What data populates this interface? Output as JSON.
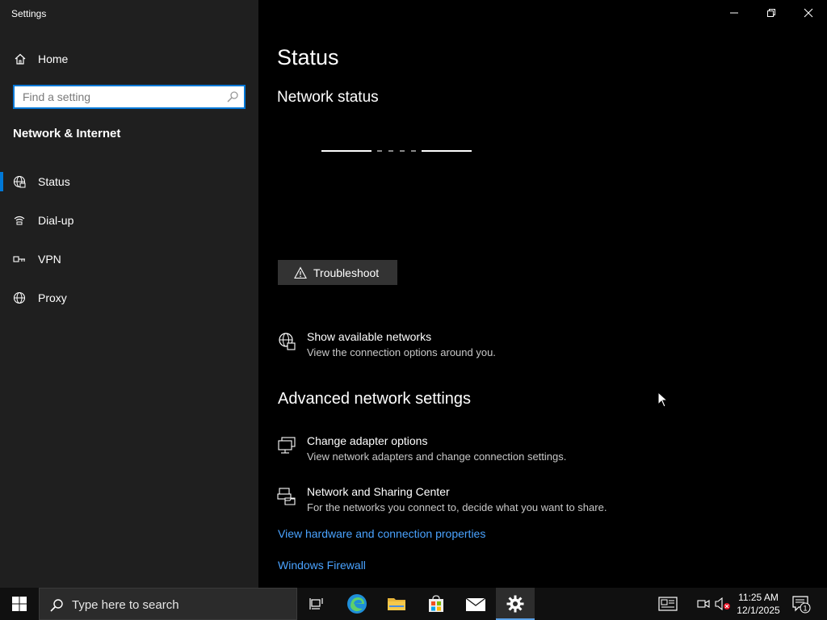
{
  "window": {
    "app_title": "Settings"
  },
  "sidebar": {
    "home_label": "Home",
    "search_placeholder": "Find a setting",
    "section_title": "Network & Internet",
    "items": [
      {
        "label": "Status",
        "icon": "globe-status-icon",
        "active": true
      },
      {
        "label": "Dial-up",
        "icon": "dialup-icon",
        "active": false
      },
      {
        "label": "VPN",
        "icon": "vpn-icon",
        "active": false
      },
      {
        "label": "Proxy",
        "icon": "globe-icon",
        "active": false
      }
    ]
  },
  "main": {
    "page_title": "Status",
    "network_status_heading": "Network status",
    "troubleshoot_label": "Troubleshoot",
    "show_networks": {
      "title": "Show available networks",
      "description": "View the connection options around you."
    },
    "advanced_heading": "Advanced network settings",
    "adapter_options": {
      "title": "Change adapter options",
      "description": "View network adapters and change connection settings."
    },
    "sharing_center": {
      "title": "Network and Sharing Center",
      "description": "For the networks you connect to, decide what you want to share."
    },
    "links": {
      "hardware": "View hardware and connection properties",
      "firewall": "Windows Firewall"
    }
  },
  "taskbar": {
    "search_placeholder": "Type here to search",
    "clock_time": "11:25 AM",
    "clock_date": "12/1/2025",
    "notification_count": "1"
  },
  "colors": {
    "accent": "#0078d7",
    "link": "#4aa3ff",
    "sidebar_bg": "#1f1f1f",
    "main_bg": "#000000"
  }
}
